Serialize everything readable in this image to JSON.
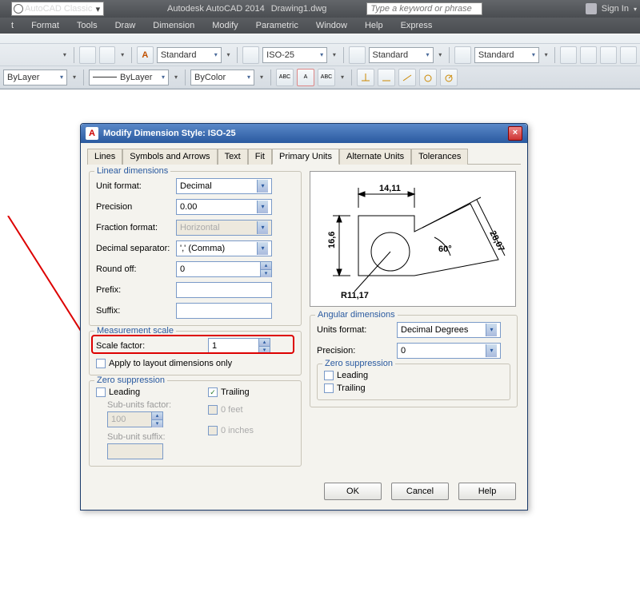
{
  "titlebar": {
    "workspace": "AutoCAD Classic",
    "app": "Autodesk AutoCAD 2014",
    "doc": "Drawing1.dwg",
    "search_placeholder": "Type a keyword or phrase",
    "signin": "Sign In"
  },
  "menu": [
    "t",
    "Format",
    "Tools",
    "Draw",
    "Dimension",
    "Modify",
    "Parametric",
    "Window",
    "Help",
    "Express"
  ],
  "toolbar": {
    "style1": "Standard",
    "style2": "ISO-25",
    "style3": "Standard",
    "style4": "Standard",
    "layer": "ByLayer",
    "line": "ByLayer",
    "color": "ByColor"
  },
  "dialog": {
    "title": "Modify Dimension Style: ISO-25",
    "tabs": [
      "Lines",
      "Symbols and Arrows",
      "Text",
      "Fit",
      "Primary Units",
      "Alternate Units",
      "Tolerances"
    ],
    "active_tab": 4,
    "linear": {
      "title": "Linear dimensions",
      "unit_format_label": "Unit format:",
      "unit_format": "Decimal",
      "precision_label": "Precision",
      "precision": "0.00",
      "fraction_label": "Fraction format:",
      "fraction": "Horizontal",
      "decsep_label": "Decimal separator:",
      "decsep": "',' (Comma)",
      "roundoff_label": "Round off:",
      "roundoff": "0",
      "prefix_label": "Prefix:",
      "prefix": "",
      "suffix_label": "Suffix:",
      "suffix": ""
    },
    "measure": {
      "title": "Measurement scale",
      "scale_label": "Scale factor:",
      "scale": "1",
      "apply_layout": "Apply to layout dimensions only"
    },
    "zero": {
      "title": "Zero suppression",
      "leading": "Leading",
      "trailing": "Trailing",
      "subfactor_label": "Sub-units factor:",
      "subfactor": "100",
      "subsuffix_label": "Sub-unit suffix:",
      "feet": "0 feet",
      "inches": "0 inches"
    },
    "angular": {
      "title": "Angular dimensions",
      "units_label": "Units format:",
      "units": "Decimal Degrees",
      "precision_label": "Precision:",
      "precision": "0",
      "zs_title": "Zero suppression",
      "leading": "Leading",
      "trailing": "Trailing"
    },
    "preview": {
      "d1": "14,11",
      "d2": "16,6",
      "d3": "28,07",
      "r": "R11,17",
      "ang": "60°"
    },
    "buttons": {
      "ok": "OK",
      "cancel": "Cancel",
      "help": "Help"
    }
  }
}
